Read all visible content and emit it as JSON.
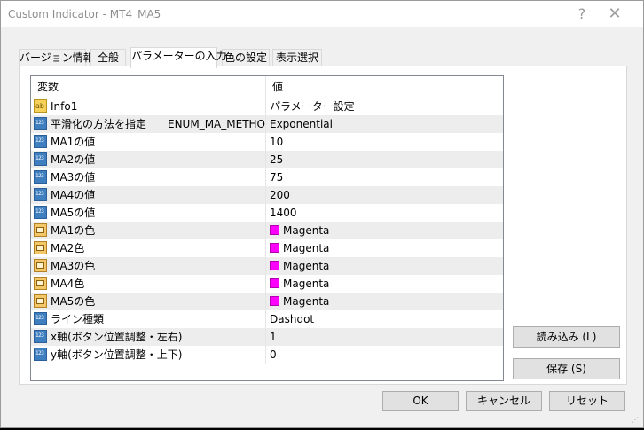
{
  "window": {
    "title": "Custom Indicator - MT4_MA5",
    "help_symbol": "?",
    "close_symbol": "✕"
  },
  "tabs": [
    {
      "label": "バージョン情報",
      "active": false
    },
    {
      "label": "全般",
      "active": false
    },
    {
      "label": "パラメーターの入力",
      "active": true
    },
    {
      "label": "色の設定",
      "active": false
    },
    {
      "label": "表示選択",
      "active": false
    }
  ],
  "grid": {
    "headers": {
      "variable": "変数",
      "value": "値"
    },
    "rows": [
      {
        "icon": "string-icon",
        "variable": "Info1",
        "value": "パラメーター設定"
      },
      {
        "icon": "number-icon",
        "variable": "平滑化の方法を指定　　ENUM_MA_METHO...",
        "value": "Exponential"
      },
      {
        "icon": "number-icon",
        "variable": "MA1の値",
        "value": "10"
      },
      {
        "icon": "number-icon",
        "variable": "MA2の値",
        "value": "25"
      },
      {
        "icon": "number-icon",
        "variable": "MA3の値",
        "value": "75"
      },
      {
        "icon": "number-icon",
        "variable": "MA4の値",
        "value": "200"
      },
      {
        "icon": "number-icon",
        "variable": "MA5の値",
        "value": "1400"
      },
      {
        "icon": "color-icon",
        "variable": "MA1の色",
        "value": "Magenta",
        "color": "#ff00ff"
      },
      {
        "icon": "color-icon",
        "variable": "MA2色",
        "value": "Magenta",
        "color": "#ff00ff"
      },
      {
        "icon": "color-icon",
        "variable": "MA3の色",
        "value": "Magenta",
        "color": "#ff00ff"
      },
      {
        "icon": "color-icon",
        "variable": "MA4色",
        "value": "Magenta",
        "color": "#ff00ff"
      },
      {
        "icon": "color-icon",
        "variable": "MA5の色",
        "value": "Magenta",
        "color": "#ff00ff"
      },
      {
        "icon": "number-icon",
        "variable": "ライン種類",
        "value": "Dashdot"
      },
      {
        "icon": "number-icon",
        "variable": "x軸(ボタン位置調整・左右)",
        "value": "1"
      },
      {
        "icon": "number-icon",
        "variable": "y軸(ボタン位置調整・上下)",
        "value": "0"
      }
    ]
  },
  "icon_text": {
    "number": "123",
    "string": "ab"
  },
  "buttons": {
    "load": "読み込み (L)",
    "save": "保存 (S)",
    "ok": "OK",
    "cancel": "キャンセル",
    "reset": "リセット"
  },
  "colors": {
    "magenta": "#ff00ff",
    "window_bg": "#f0f0f0",
    "row_alt": "#ededed"
  }
}
